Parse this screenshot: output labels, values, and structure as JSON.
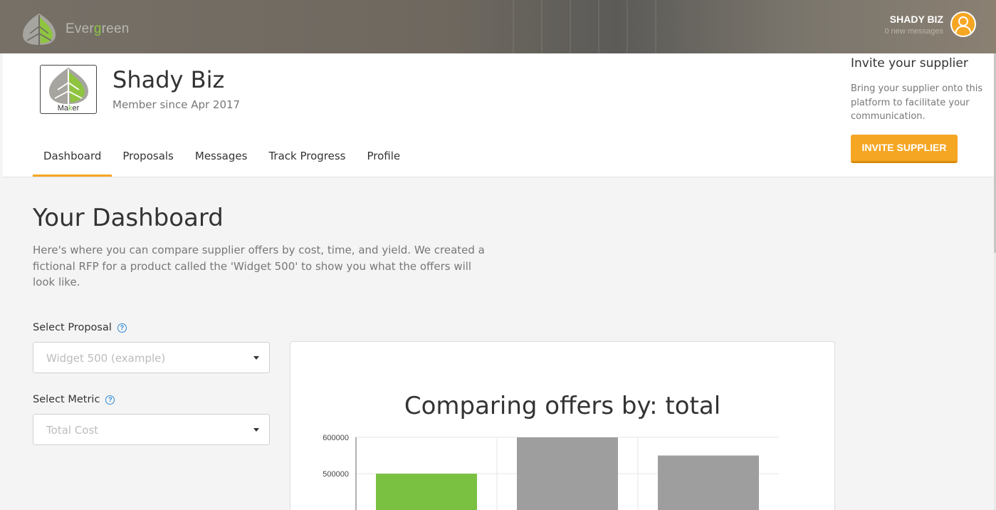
{
  "topbar": {
    "brand_prefix": "Ever",
    "brand_g": "g",
    "brand_suffix": "reen",
    "user_name": "SHADY BIZ",
    "messages": "0 new messages"
  },
  "company": {
    "name": "Shady Biz",
    "member_since": "Member since Apr 2017",
    "logo_text_a": "Ma",
    "logo_text_k": "k",
    "logo_text_b": "er"
  },
  "tabs": [
    {
      "label": "Dashboard",
      "active": true
    },
    {
      "label": "Proposals",
      "active": false
    },
    {
      "label": "Messages",
      "active": false
    },
    {
      "label": "Track Progress",
      "active": false
    },
    {
      "label": "Profile",
      "active": false
    }
  ],
  "invite": {
    "title": "Invite your supplier",
    "text": "Bring your supplier onto this platform to facilitate your communication.",
    "button": "INVITE SUPPLIER"
  },
  "dashboard": {
    "title": "Your Dashboard",
    "description": "Here's where you can compare supplier offers by cost, time, and yield. We created a fictional RFP for a product called the 'Widget 500' to show you what the offers will look like.",
    "proposal_label": "Select Proposal",
    "proposal_value": "Widget 500 (example)",
    "metric_label": "Select Metric",
    "metric_value": "Total Cost",
    "help_glyph": "?"
  },
  "colors": {
    "accent": "#f5a623",
    "highlight_bar": "#7ac142",
    "other_bar": "#9e9e9e"
  },
  "chart_data": {
    "type": "bar",
    "title": "Comparing offers by: total",
    "yticks": [
      600000,
      500000
    ],
    "ylim": [
      400000,
      600000
    ],
    "values": [
      500000,
      600000,
      550000
    ],
    "bar_colors": [
      "#7ac142",
      "#9e9e9e",
      "#9e9e9e"
    ],
    "grid": true
  }
}
